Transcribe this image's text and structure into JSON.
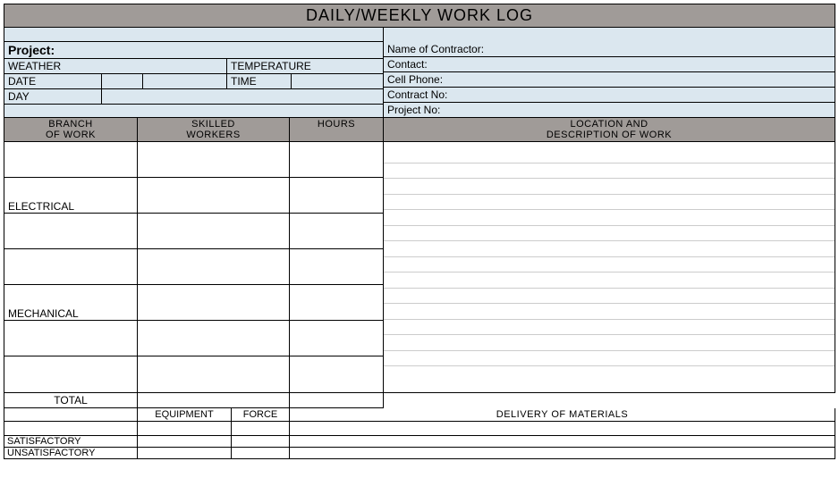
{
  "title": "DAILY/WEEKLY WORK LOG",
  "left": {
    "project_label": "Project:",
    "weather_label": "WEATHER",
    "temperature_label": "TEMPERATURE",
    "date_label": "DATE",
    "time_label": "TIME",
    "day_label": "DAY"
  },
  "right": {
    "contractor_label": "Name of Contractor:",
    "contact_label": "Contact:",
    "cell_label": "Cell Phone:",
    "contract_no_label": "Contract No:",
    "project_no_label": "Project No:"
  },
  "headers": {
    "branch1": "BRANCH",
    "branch2": "OF WORK",
    "skilled1": "SKILLED",
    "skilled2": "WORKERS",
    "hours": "HOURS",
    "location1": "LOCATION AND",
    "location2": "DESCRIPTION OF WORK"
  },
  "work_rows": [
    "",
    "ELECTRICAL",
    "",
    "",
    "MECHANICAL",
    "",
    ""
  ],
  "total_label": "TOTAL",
  "equipment_label": "EQUIPMENT",
  "force_label": "FORCE",
  "delivery_label": "DELIVERY OF MATERIALS",
  "satisfactory_label": "SATISFACTORY",
  "unsatisfactory_label": "UNSATISFACTORY"
}
